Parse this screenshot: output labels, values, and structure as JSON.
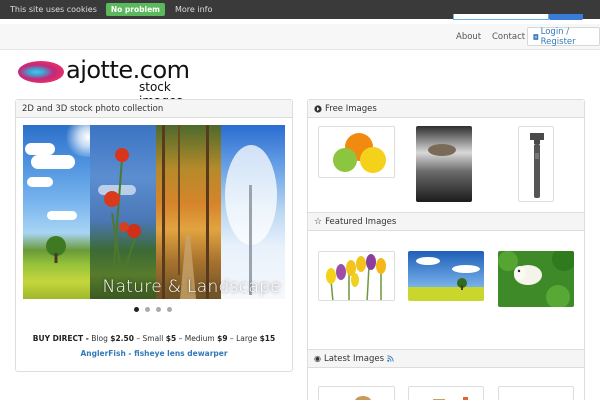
{
  "cookie_bar": {
    "message": "This site uses cookies",
    "accept_label": "No problem",
    "more_label": "More info"
  },
  "nav": {
    "about": "About",
    "contact": "Contact",
    "login": "Login / Register"
  },
  "logo": {
    "name": "ajotte.com",
    "tagline": "stock images"
  },
  "left_panel": {
    "title": "2D and 3D stock photo collection",
    "slide_caption": "Nature & Landscape",
    "slide_count": 4,
    "active_slide": 1,
    "buy_direct": "BUY DIRECT -",
    "pricing": [
      {
        "label": "Blog",
        "price": "$2.50"
      },
      {
        "label": "Small",
        "price": "$5"
      },
      {
        "label": "Medium",
        "price": "$9"
      },
      {
        "label": "Large",
        "price": "$15"
      }
    ],
    "promo_link": "AnglerFish - fisheye lens dewarper"
  },
  "free_images": {
    "title": "Free Images",
    "items": [
      "citrus fruits",
      "rock in water",
      "adjustable wrench"
    ]
  },
  "featured_images": {
    "title": "Featured Images",
    "items": [
      "tulips",
      "tree on field",
      "toy sheep on grass"
    ]
  },
  "latest_images": {
    "title": "Latest Images"
  },
  "colors": {
    "cookie_bar_bg": "#3a3a3a",
    "accept_button": "#5cb85c",
    "link": "#337ab7",
    "panel_header": "#f5f5f5"
  }
}
